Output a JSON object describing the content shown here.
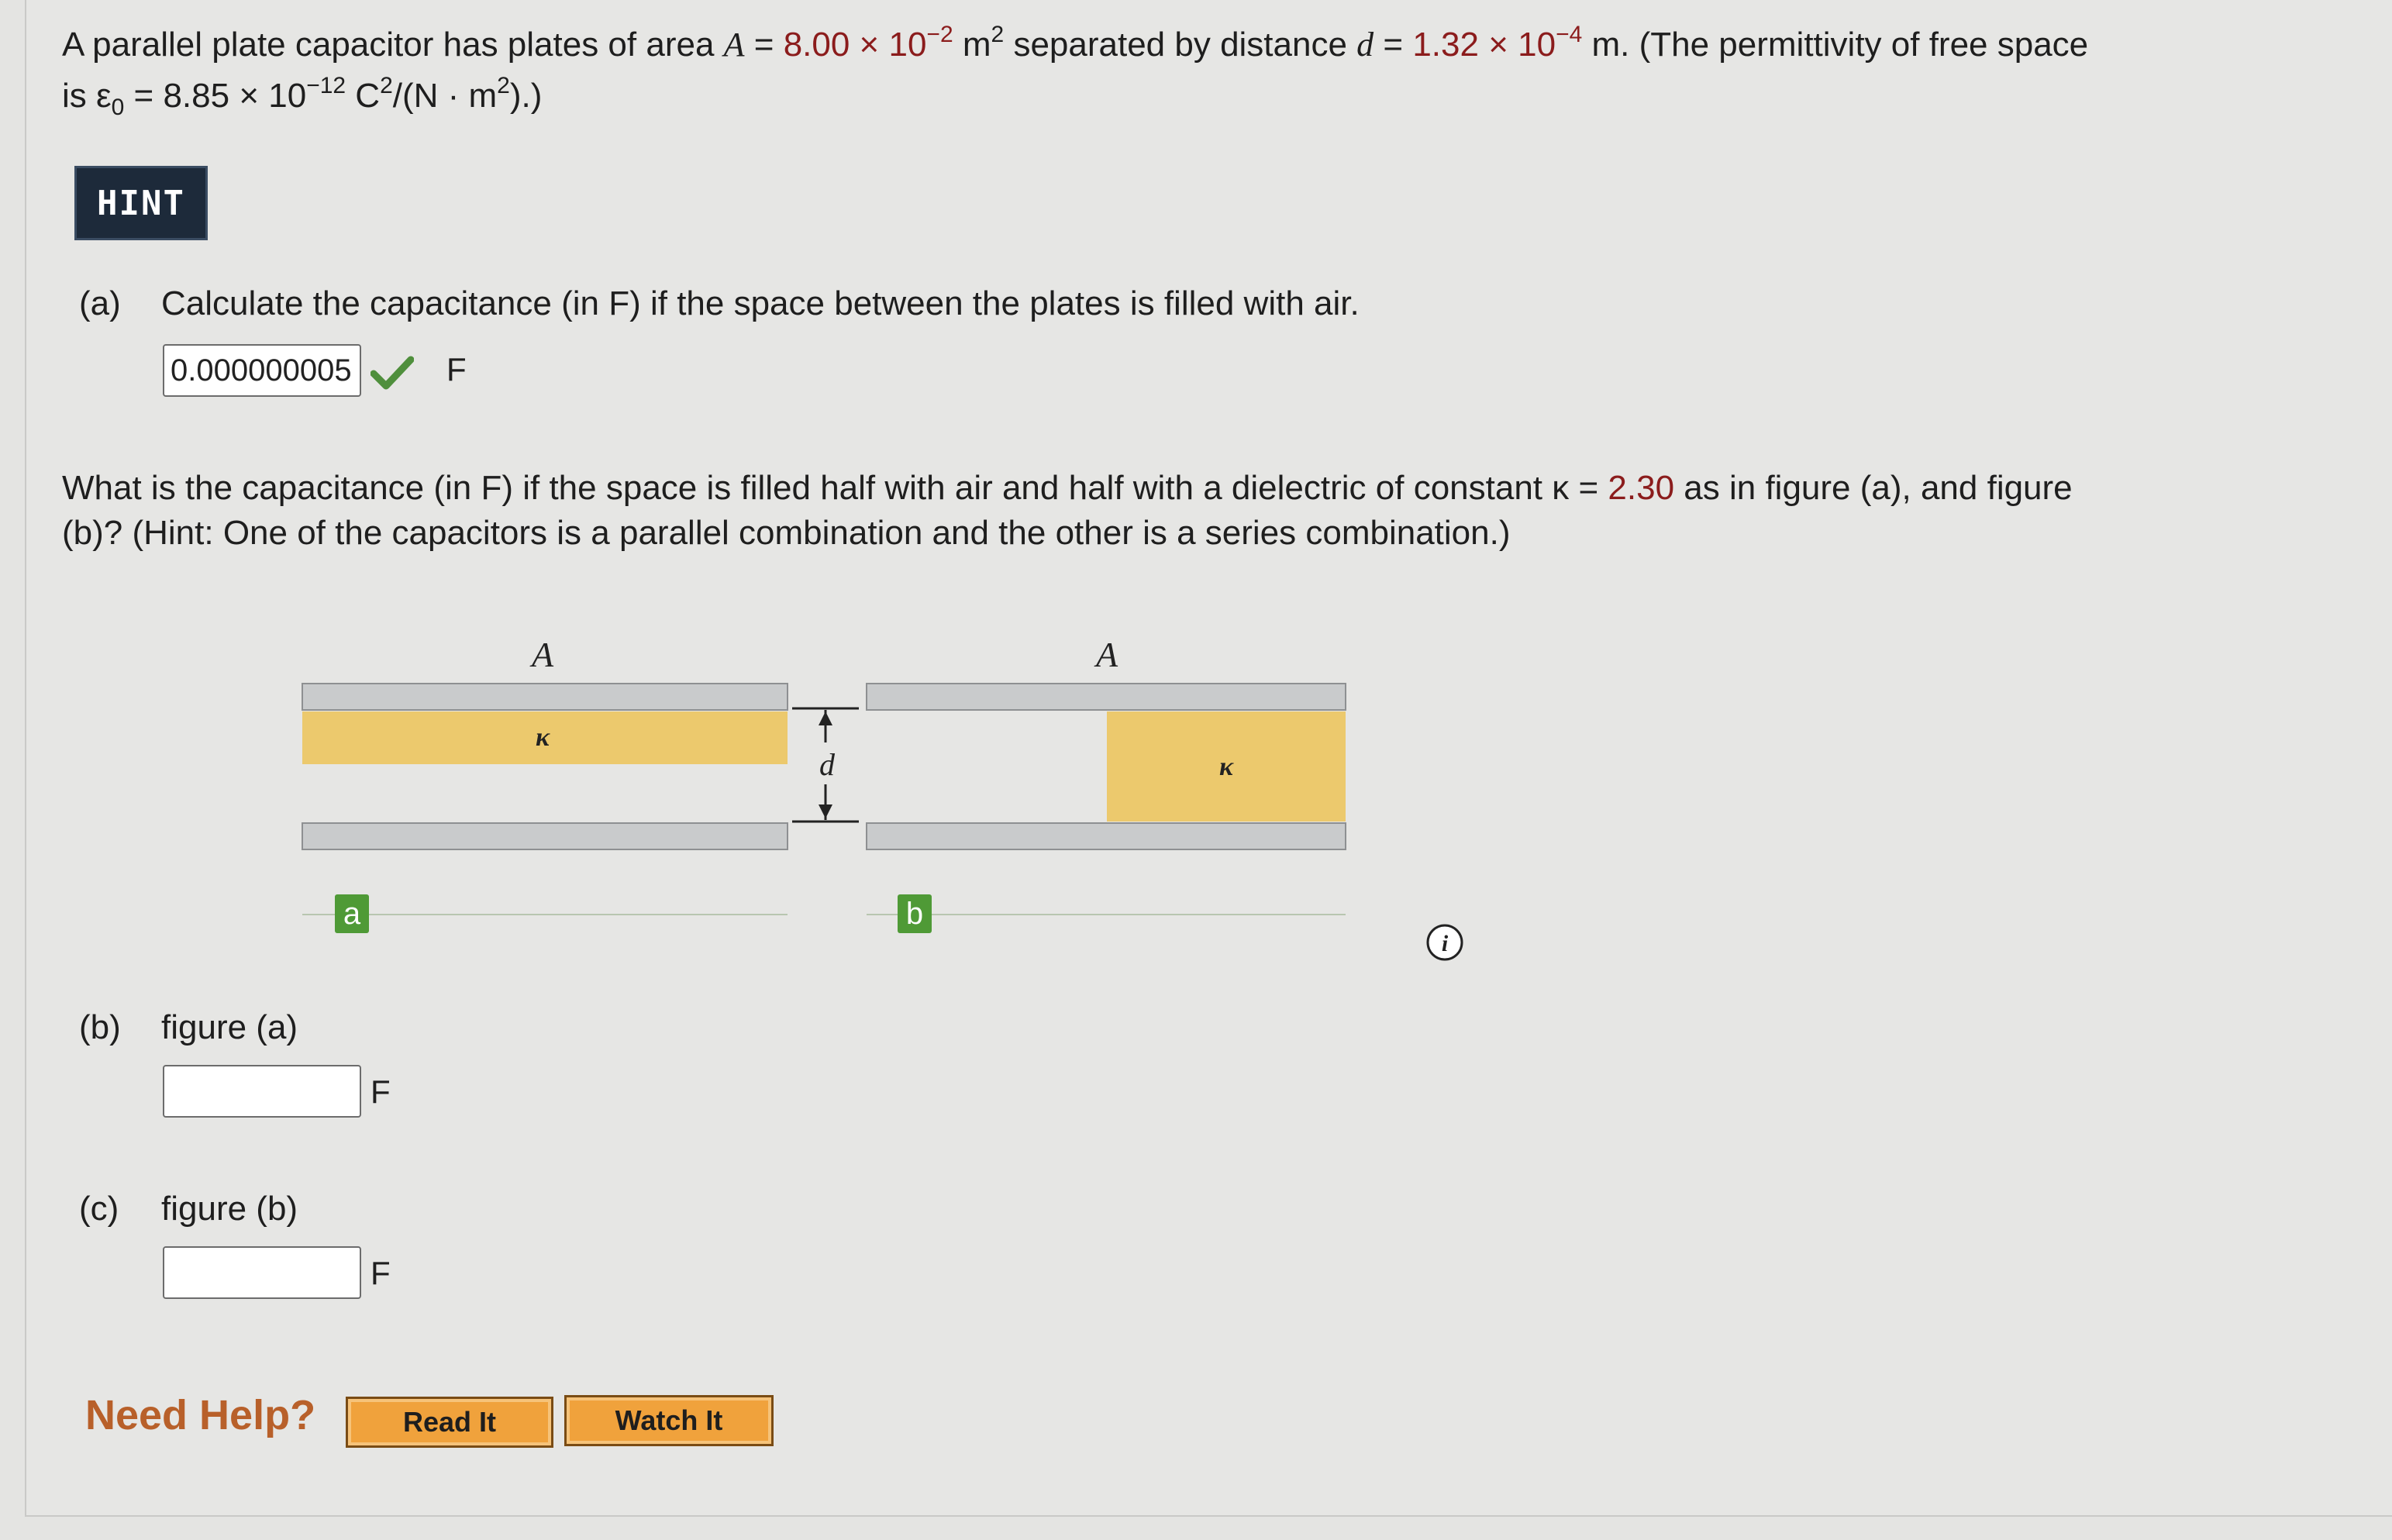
{
  "problem": {
    "line1_a": "A parallel plate capacitor has plates of area ",
    "var_A": "A",
    "eq": " = ",
    "area_mantissa": "8.00 × 10",
    "area_exp": "−2",
    "area_unit": " m",
    "area_unit_exp": "2",
    "line1_b": " separated by distance ",
    "var_d": "d",
    "dist_mantissa": "1.32 × 10",
    "dist_exp": "−4",
    "line1_c": " m. (The permittivity of free space",
    "line2_a": "is ε",
    "eps_sub": "0",
    "line2_b": " = 8.85 × 10",
    "eps_exp": "−12",
    "line2_c": " C",
    "c_exp": "2",
    "line2_d": "/(N · m",
    "m_exp": "2",
    "line2_e": ").)"
  },
  "hint_button": "HINT",
  "part_a": {
    "label": "(a)",
    "question": "Calculate the capacitance (in F) if the space between the plates is filled with air.",
    "answer": "0.000000005",
    "unit": "F"
  },
  "question2": {
    "line1_a": "What is the capacitance (in F) if the space is filled half with air and half with a dielectric of constant κ = ",
    "kappa": "2.30",
    "line1_b": " as in figure (a), and figure",
    "line2": "(b)? (Hint: One of the capacitors is a parallel combination and the other is a series combination.)"
  },
  "figure": {
    "plate_label": "A",
    "kappa_symbol": "κ",
    "distance_label": "d",
    "label_a": "a",
    "label_b": "b",
    "dielectric_color": "#ecc96d",
    "plate_color": "#c9cbcc"
  },
  "part_b": {
    "label": "(b)",
    "text": "figure (a)",
    "value": "",
    "unit": "F"
  },
  "part_c": {
    "label": "(c)",
    "text": "figure (b)",
    "value": "",
    "unit": "F"
  },
  "help": {
    "label": "Need Help?",
    "read_button": "Read It",
    "watch_button": "Watch It"
  }
}
